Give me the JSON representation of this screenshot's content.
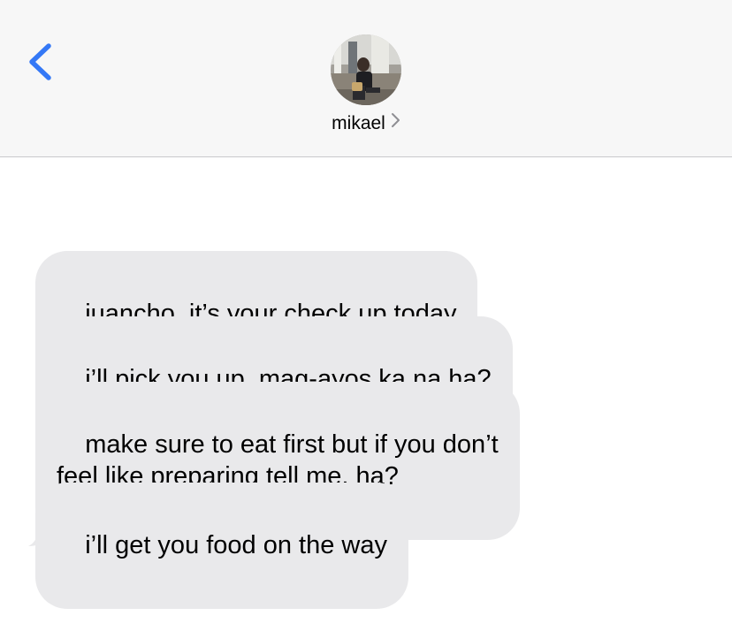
{
  "header": {
    "contact_name": "mikael",
    "back_icon": "chevron-left-icon",
    "name_chevron_icon": "chevron-right-icon",
    "accent_color": "#3478f6"
  },
  "messages": [
    {
      "text": "juancho, it’s your check up today",
      "direction": "received"
    },
    {
      "text": "i’ll pick you up. mag-ayos ka na ha?",
      "direction": "received"
    },
    {
      "text": "make sure to eat first but if you don’t\nfeel like preparing tell me, ha?",
      "direction": "received"
    },
    {
      "text": "i’ll get you food on the way",
      "direction": "received"
    }
  ]
}
